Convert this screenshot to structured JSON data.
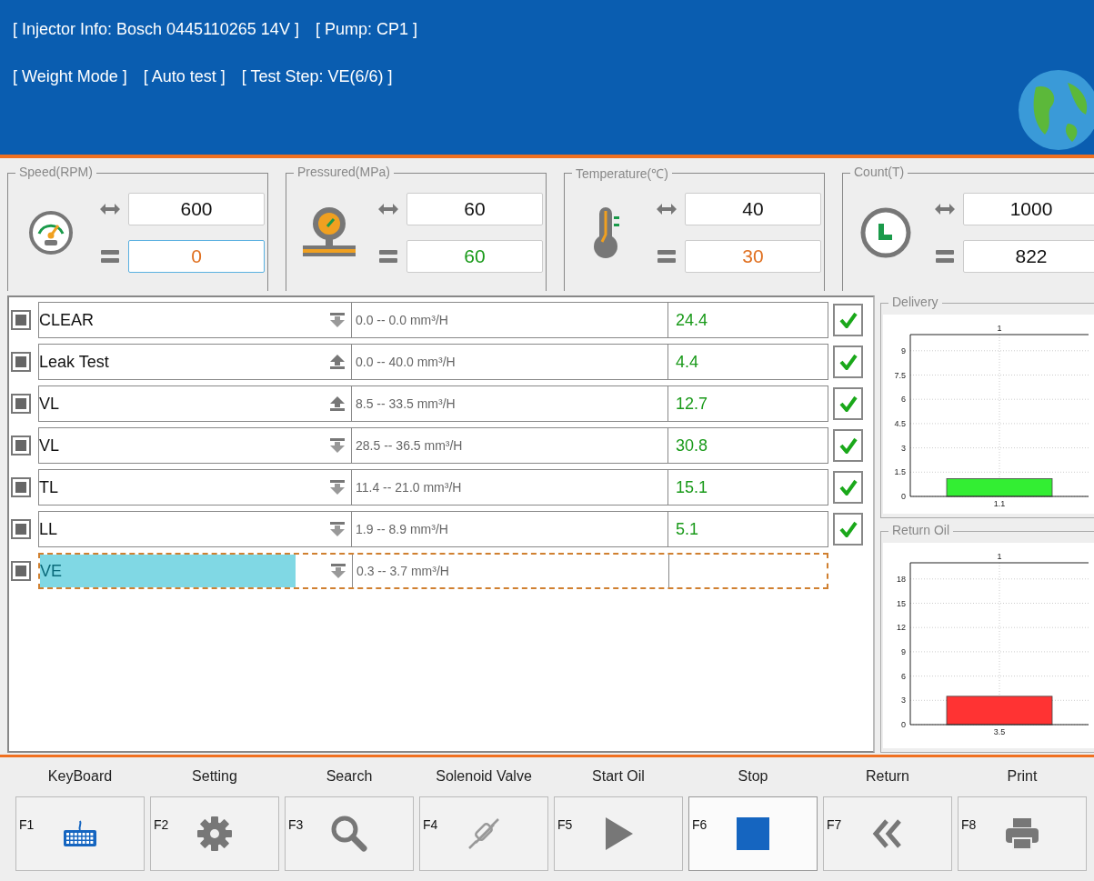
{
  "header": {
    "lines": [
      [
        "[ Injector Info: Bosch  0445110265  14V ]",
        "[ Pump: CP1 ]"
      ],
      [
        "[ Weight Mode ]",
        "[ Auto test ]",
        "[ Test Step: VE(6/6) ]"
      ]
    ]
  },
  "gauges": [
    {
      "kind": "speed",
      "title": "Speed(RPM)",
      "target": "600",
      "actual": "0",
      "color": "#e07020",
      "focused": true
    },
    {
      "kind": "pressure",
      "title": "Pressured(MPa)",
      "target": "60",
      "actual": "60",
      "color": "#1a9a1a",
      "focused": false
    },
    {
      "kind": "temperature",
      "title": "Temperature(℃)",
      "target": "40",
      "actual": "30",
      "color": "#e07020",
      "focused": false
    },
    {
      "kind": "count",
      "title": "Count(T)",
      "target": "1000",
      "actual": "822",
      "color": "#111111",
      "focused": false
    }
  ],
  "steps": [
    {
      "checked": true,
      "name": "CLEAR",
      "kind": "down",
      "range": "0.0 -- 0.0 mm³/H",
      "result": "24.4",
      "passed": true,
      "selected": false
    },
    {
      "checked": true,
      "name": "Leak Test",
      "kind": "up",
      "range": "0.0 -- 40.0 mm³/H",
      "result": "4.4",
      "passed": true,
      "selected": false
    },
    {
      "checked": true,
      "name": "VL",
      "kind": "up",
      "range": "8.5 -- 33.5 mm³/H",
      "result": "12.7",
      "passed": true,
      "selected": false
    },
    {
      "checked": true,
      "name": "VL",
      "kind": "down",
      "range": "28.5 -- 36.5 mm³/H",
      "result": "30.8",
      "passed": true,
      "selected": false
    },
    {
      "checked": true,
      "name": "TL",
      "kind": "down",
      "range": "11.4 -- 21.0 mm³/H",
      "result": "15.1",
      "passed": true,
      "selected": false
    },
    {
      "checked": true,
      "name": "LL",
      "kind": "down",
      "range": "1.9 -- 8.9 mm³/H",
      "result": "5.1",
      "passed": true,
      "selected": false
    },
    {
      "checked": true,
      "name": "VE",
      "kind": "down",
      "range": "0.3 -- 3.7 mm³/H",
      "passed": false,
      "selected": true,
      "level": 0.82
    }
  ],
  "charts": [
    {
      "title": "Delivery",
      "chart_data": {
        "type": "bar",
        "categories": [
          "1"
        ],
        "series": [
          {
            "color": "#33ee33",
            "values": [
              1.1
            ]
          }
        ],
        "ylim": [
          0,
          10
        ],
        "yticks": [
          0,
          1.5,
          3,
          4.5,
          6,
          7.5,
          9
        ],
        "grid": true,
        "data_labels": true
      }
    },
    {
      "title": "Return Oil",
      "chart_data": {
        "type": "bar",
        "categories": [
          "1"
        ],
        "series": [
          {
            "color": "#ff3333",
            "values": [
              3.5
            ]
          }
        ],
        "ylim": [
          0,
          20
        ],
        "yticks": [
          0,
          3,
          6,
          9,
          12,
          15,
          18
        ],
        "grid": true,
        "data_labels": true
      }
    }
  ],
  "toolbar": [
    {
      "label": "KeyBoard",
      "key": "F1",
      "kind": "keyboard",
      "pressed": false
    },
    {
      "label": "Setting",
      "key": "F2",
      "kind": "gear",
      "pressed": false
    },
    {
      "label": "Search",
      "key": "F3",
      "kind": "search",
      "pressed": false
    },
    {
      "label": "Solenoid Valve",
      "key": "F4",
      "kind": "valve",
      "pressed": false
    },
    {
      "label": "Start Oil",
      "key": "F5",
      "kind": "play",
      "pressed": false
    },
    {
      "label": "Stop",
      "key": "F6",
      "kind": "stop",
      "pressed": true
    },
    {
      "label": "Return",
      "key": "F7",
      "kind": "rewind",
      "pressed": false
    },
    {
      "label": "Print",
      "key": "F8",
      "kind": "printer",
      "pressed": false
    }
  ]
}
